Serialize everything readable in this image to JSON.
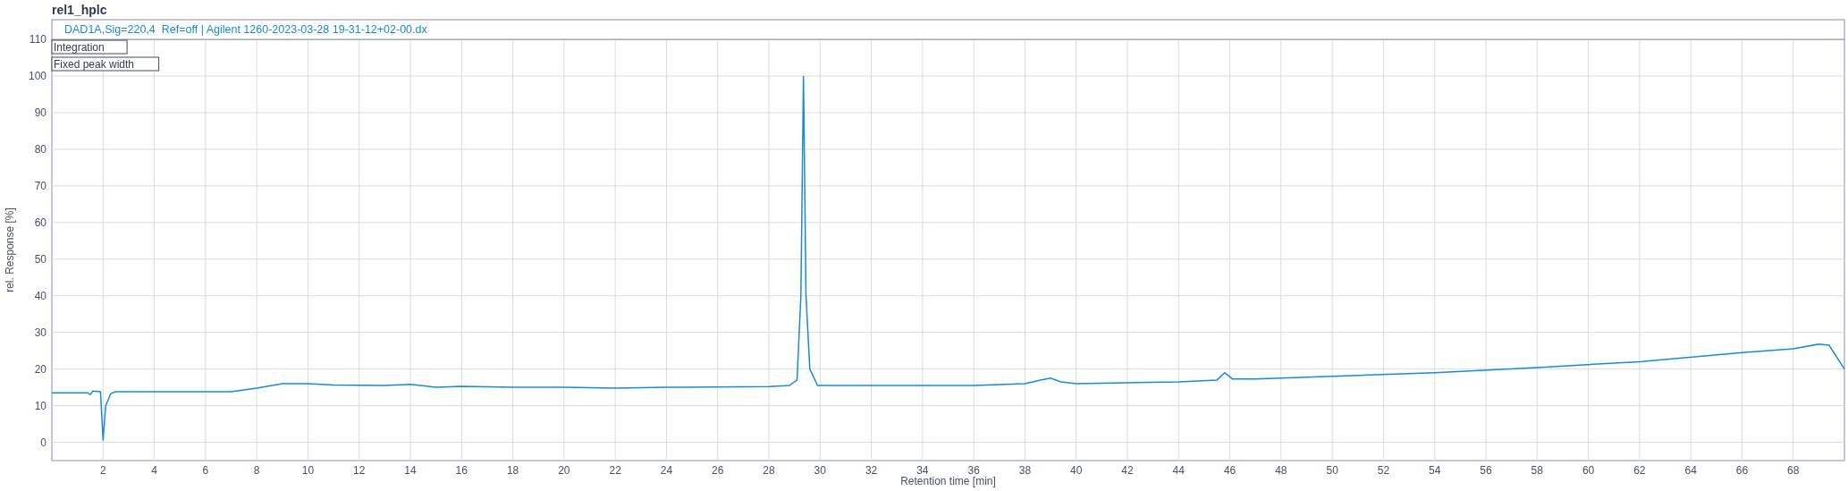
{
  "title": "rel1_hplc",
  "chart": {
    "chart_data": {
      "type": "line",
      "xlabel": "Retention time [min]",
      "ylabel": "rel. Response [%]",
      "x": [
        0,
        1.4,
        1.5,
        1.6,
        1.9,
        2.0,
        2.1,
        2.3,
        2.5,
        5,
        7,
        8,
        9,
        10,
        11,
        13,
        14,
        15,
        16,
        18,
        20,
        22,
        24,
        28,
        28.8,
        29.1,
        29.25,
        29.35,
        29.45,
        29.6,
        29.9,
        32,
        36,
        38,
        38.6,
        39,
        39.4,
        40,
        44,
        45.5,
        45.8,
        46.1,
        47,
        50,
        54,
        58,
        62,
        66,
        68,
        69,
        69.4,
        70
      ],
      "series": [
        {
          "name": "DAD1A,Sig=220,4  Ref=off | Agilent 1260-2023-03-28 19-31-12+02-00.dx",
          "color": "#1a8ad4",
          "values": [
            13.5,
            13.5,
            13,
            14,
            13.8,
            0.5,
            10,
            13.3,
            13.8,
            13.8,
            13.8,
            14.8,
            16,
            16,
            15.6,
            15.5,
            15.8,
            15,
            15.3,
            15,
            15,
            14.8,
            15,
            15.2,
            15.5,
            17,
            40,
            100,
            40,
            20,
            15.5,
            15.5,
            15.5,
            16,
            17,
            17.5,
            16.5,
            16,
            16.5,
            17,
            19,
            17.3,
            17.3,
            18,
            19,
            20.4,
            22,
            24.5,
            25.5,
            26.8,
            26.5,
            20
          ]
        }
      ],
      "grid": true,
      "xlim": [
        0,
        70
      ],
      "ylim": [
        -5,
        110
      ],
      "xticks": [
        2,
        4,
        6,
        8,
        10,
        12,
        14,
        16,
        18,
        20,
        22,
        24,
        26,
        28,
        30,
        32,
        34,
        36,
        38,
        40,
        42,
        44,
        46,
        48,
        50,
        52,
        54,
        56,
        58,
        60,
        62,
        64,
        66,
        68
      ],
      "yticks": [
        0,
        10,
        20,
        30,
        40,
        50,
        60,
        70,
        80,
        90,
        100,
        110
      ],
      "annotations": [
        "Integration",
        "Fixed peak width"
      ]
    }
  }
}
